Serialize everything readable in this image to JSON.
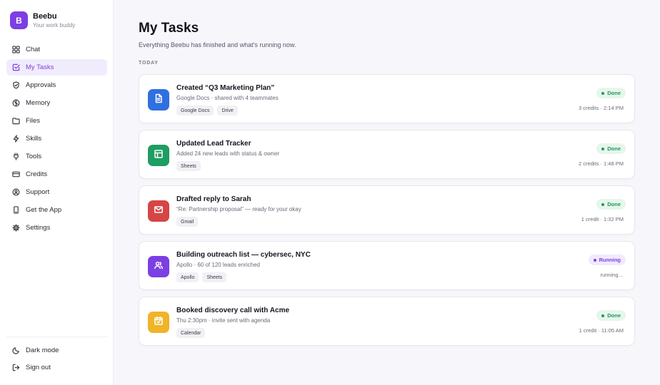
{
  "brand": {
    "initial": "B",
    "name": "Beebu",
    "tagline": "Your work buddy",
    "accent": "#7b3fe4"
  },
  "sidebar": {
    "items": [
      {
        "label": "Chat",
        "icon": "grid-icon",
        "active": false
      },
      {
        "label": "My Tasks",
        "icon": "checkbox-icon",
        "active": true
      },
      {
        "label": "Approvals",
        "icon": "shield-check-icon",
        "active": false
      },
      {
        "label": "Memory",
        "icon": "brain-icon",
        "active": false
      },
      {
        "label": "Files",
        "icon": "folder-icon",
        "active": false
      },
      {
        "label": "Skills",
        "icon": "bolt-icon",
        "active": false
      },
      {
        "label": "Tools",
        "icon": "plug-icon",
        "active": false
      },
      {
        "label": "Credits",
        "icon": "credit-card-icon",
        "active": false
      },
      {
        "label": "Support",
        "icon": "lifebuoy-icon",
        "active": false
      },
      {
        "label": "Get the App",
        "icon": "phone-icon",
        "active": false
      },
      {
        "label": "Settings",
        "icon": "gear-icon",
        "active": false
      }
    ],
    "footer": [
      {
        "label": "Dark mode",
        "icon": "moon-icon"
      },
      {
        "label": "Sign out",
        "icon": "sign-out-icon"
      }
    ]
  },
  "main": {
    "title": "My Tasks",
    "subtitle": "Everything Beebu has finished and what's running now.",
    "section_label": "TODAY",
    "tasks": [
      {
        "title": "Created “Q3 Marketing Plan”",
        "description": "Google Docs · shared with 4 teammates",
        "tags": [
          "Google Docs",
          "Drive"
        ],
        "status": "Done",
        "meta": "3 credits · 2:14 PM",
        "icon": "document-icon",
        "color": "#2f6fe0"
      },
      {
        "title": "Updated Lead Tracker",
        "description": "Added 24 new leads with status & owner",
        "tags": [
          "Sheets"
        ],
        "status": "Done",
        "meta": "2 credits · 1:48 PM",
        "icon": "spreadsheet-icon",
        "color": "#1f9d62"
      },
      {
        "title": "Drafted reply to Sarah",
        "description": "“Re: Partnership proposal” — ready for your okay",
        "tags": [
          "Gmail"
        ],
        "status": "Done",
        "meta": "1 credit · 1:32 PM",
        "icon": "mail-icon",
        "color": "#d64545"
      },
      {
        "title": "Building outreach list — cybersec, NYC",
        "description": "Apollo · 60 of 120 leads enriched",
        "tags": [
          "Apollo",
          "Sheets"
        ],
        "status": "Running",
        "meta": "running…",
        "icon": "users-icon",
        "color": "#7b3fe4"
      },
      {
        "title": "Booked discovery call with Acme",
        "description": "Thu 2:30pm · invite sent with agenda",
        "tags": [
          "Calendar"
        ],
        "status": "Done",
        "meta": "1 credit · 11:05 AM",
        "icon": "calendar-icon",
        "color": "#f0b429"
      }
    ]
  }
}
